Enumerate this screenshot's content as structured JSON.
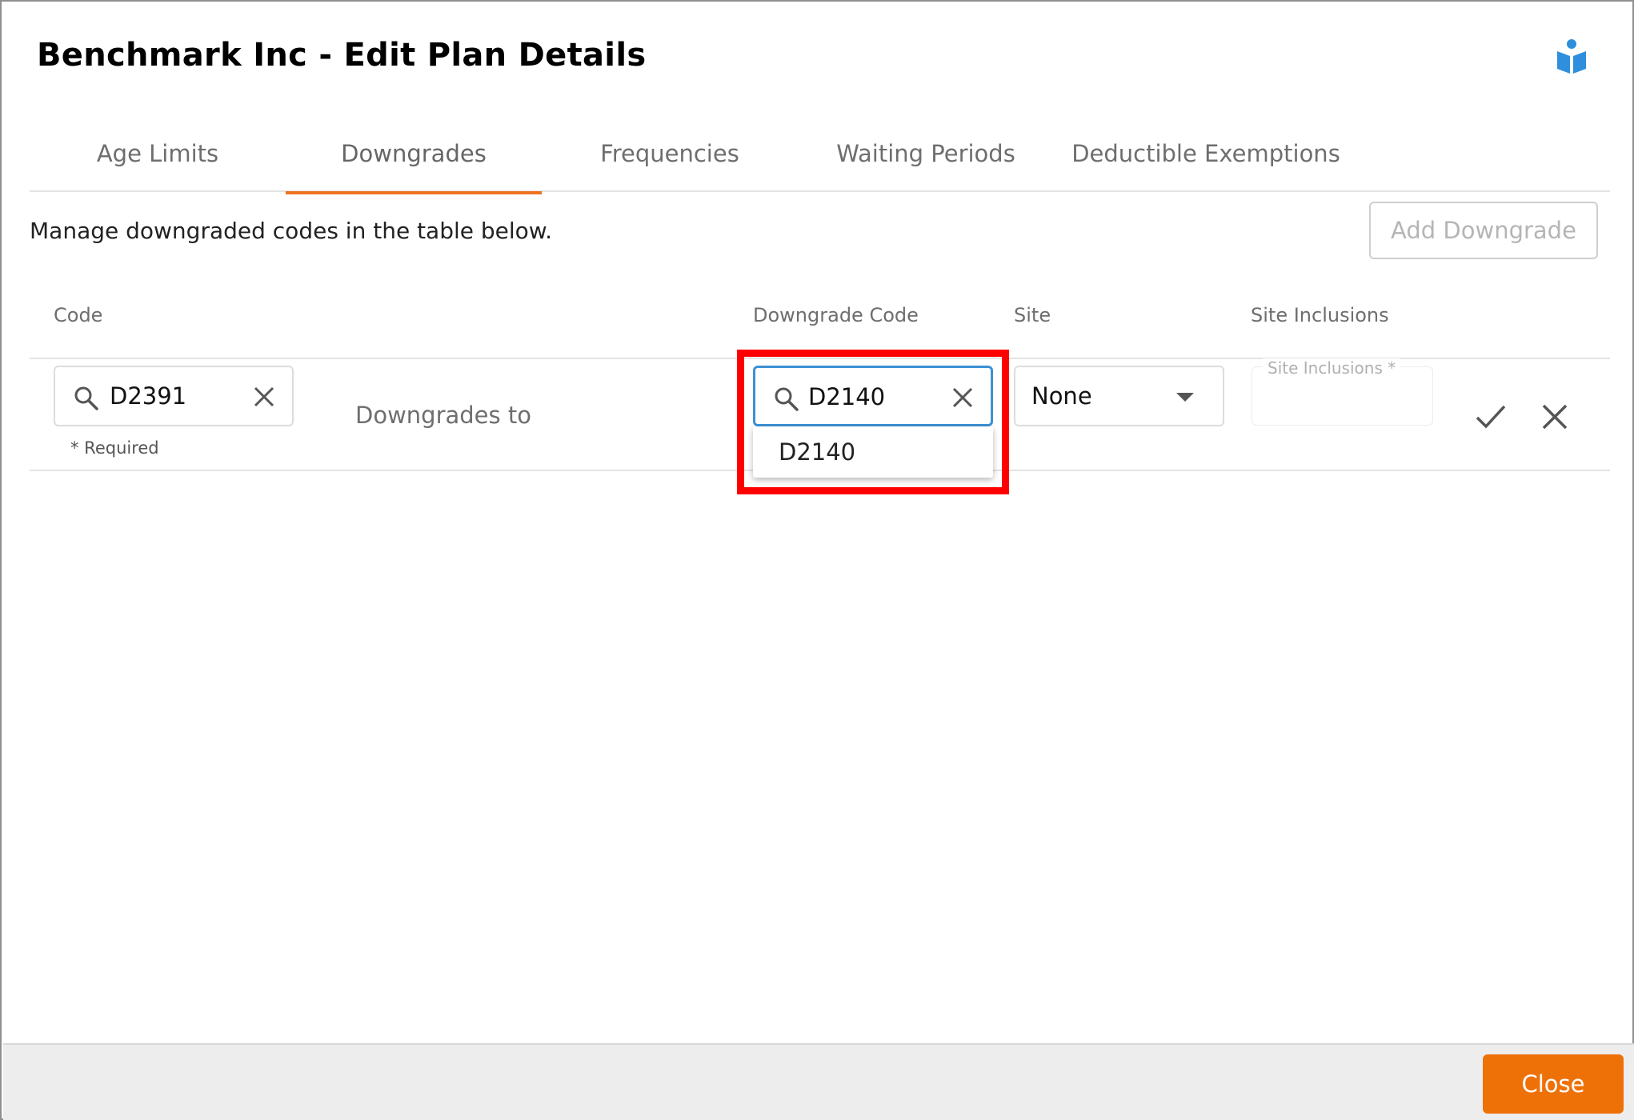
{
  "dialog": {
    "title": "Benchmark Inc - Edit Plan Details",
    "help_icon": "book-reader-icon",
    "accent_color": "#ee7220",
    "focus_color": "#3d91d4"
  },
  "tabs": [
    {
      "label": "Age Limits",
      "active": false
    },
    {
      "label": "Downgrades",
      "active": true
    },
    {
      "label": "Frequencies",
      "active": false
    },
    {
      "label": "Waiting Periods",
      "active": false
    },
    {
      "label": "Deductible Exemptions",
      "active": false
    }
  ],
  "section": {
    "intro": "Manage downgraded codes in the table below.",
    "add_button": "Add Downgrade"
  },
  "table": {
    "headers": {
      "code": "Code",
      "downgrade_code": "Downgrade Code",
      "site": "Site",
      "site_inclusions": "Site Inclusions"
    },
    "row": {
      "code_value": "D2391",
      "required_note": "* Required",
      "downgrades_to": "Downgrades to",
      "downgrade_code_value": "D2140",
      "dropdown_options": [
        "D2140"
      ],
      "site_value": "None",
      "site_inclusions_placeholder": "Site Inclusions *"
    }
  },
  "footer": {
    "close_button": "Close"
  }
}
